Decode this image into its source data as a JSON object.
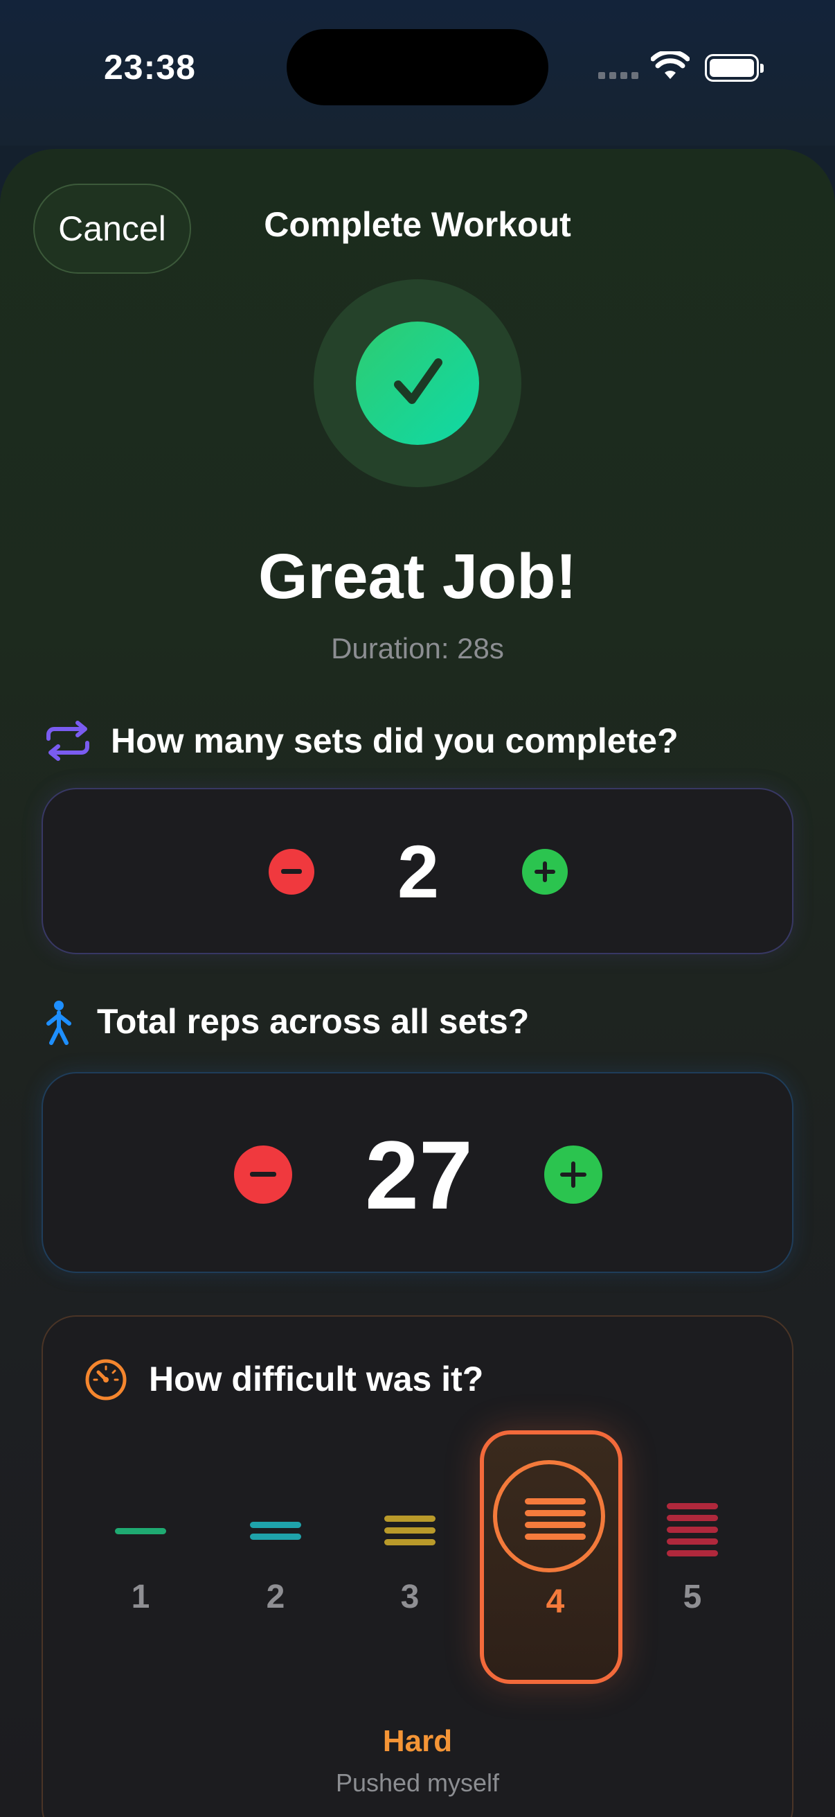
{
  "status_bar": {
    "time": "23:38"
  },
  "header": {
    "cancel_label": "Cancel",
    "title": "Complete Workout"
  },
  "summary": {
    "headline": "Great Job!",
    "duration": "Duration: 28s"
  },
  "sets": {
    "question": "How many sets did you complete?",
    "value": "2",
    "icon": "repeat-icon"
  },
  "reps": {
    "question": "Total reps across all sets?",
    "value": "27",
    "icon": "walking-figure-icon"
  },
  "difficulty": {
    "question": "How difficult was it?",
    "icon": "gauge-icon",
    "options": [
      {
        "number": "1",
        "color": "#1faa72"
      },
      {
        "number": "2",
        "color": "#1fa3ab"
      },
      {
        "number": "3",
        "color": "#b99a2a"
      },
      {
        "number": "4",
        "color": "#f57b3c"
      },
      {
        "number": "5",
        "color": "#b0283c"
      }
    ],
    "selected": "4",
    "selected_label": "Hard",
    "selected_description": "Pushed myself"
  },
  "colors": {
    "minus": "#f0393e",
    "plus": "#2bc44f",
    "accent_check": "#0fd9a6",
    "difficulty_accent": "#f57b3c"
  }
}
